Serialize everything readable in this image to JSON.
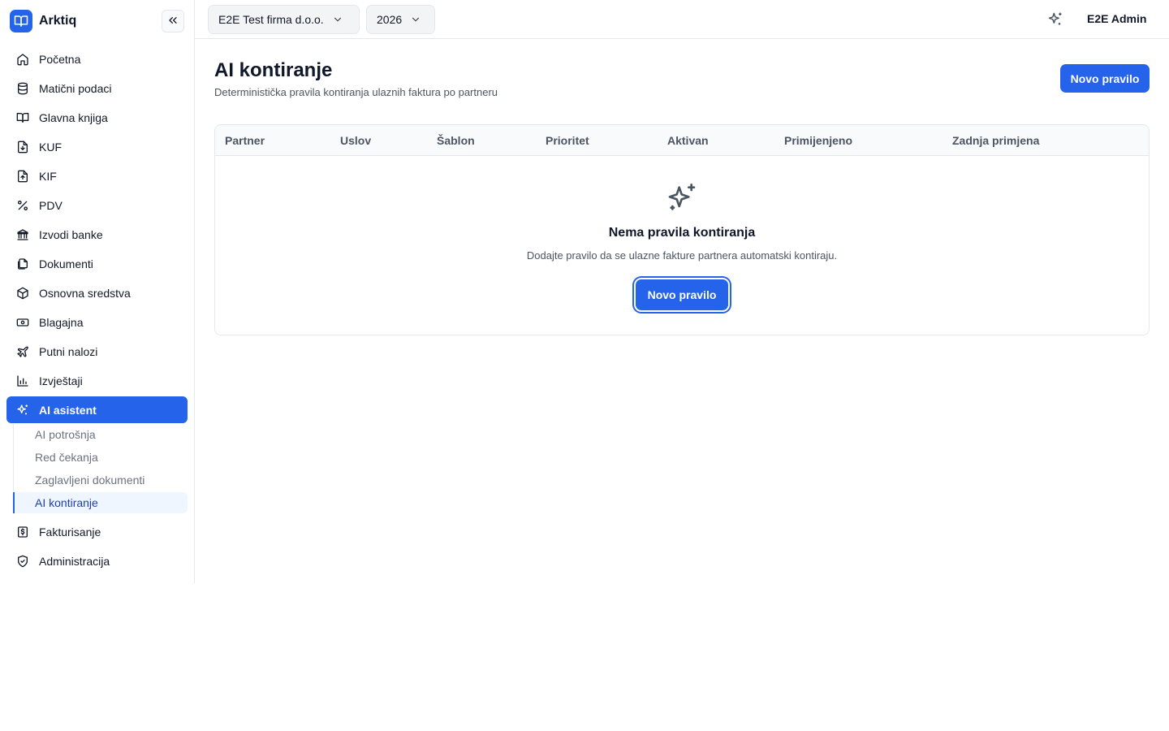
{
  "app": {
    "name": "Arktiq"
  },
  "topbar": {
    "company": "E2E Test firma d.o.o.",
    "year": "2026",
    "user": "E2E Admin"
  },
  "sidebar": {
    "items": [
      {
        "label": "Početna",
        "icon": "home-icon"
      },
      {
        "label": "Matični podaci",
        "icon": "database-icon"
      },
      {
        "label": "Glavna knjiga",
        "icon": "book-open-icon"
      },
      {
        "label": "KUF",
        "icon": "file-download-icon"
      },
      {
        "label": "KIF",
        "icon": "file-upload-icon"
      },
      {
        "label": "PDV",
        "icon": "percent-icon"
      },
      {
        "label": "Izvodi banke",
        "icon": "bank-icon"
      },
      {
        "label": "Dokumenti",
        "icon": "files-icon"
      },
      {
        "label": "Osnovna sredstva",
        "icon": "package-icon"
      },
      {
        "label": "Blagajna",
        "icon": "banknote-icon"
      },
      {
        "label": "Putni nalozi",
        "icon": "plane-icon"
      },
      {
        "label": "Izvještaji",
        "icon": "bar-chart-icon"
      },
      {
        "label": "AI asistent",
        "icon": "sparkles-icon"
      },
      {
        "label": "Fakturisanje",
        "icon": "invoice-dollar-icon"
      },
      {
        "label": "Administracija",
        "icon": "shield-check-icon"
      }
    ],
    "ai_sub": [
      {
        "label": "AI potrošnja"
      },
      {
        "label": "Red čekanja"
      },
      {
        "label": "Zaglavljeni dokumenti"
      },
      {
        "label": "AI kontiranje"
      }
    ]
  },
  "page": {
    "title": "AI kontiranje",
    "subtitle": "Deterministička pravila kontiranja ulaznih faktura po partneru",
    "new_rule_label": "Novo pravilo"
  },
  "table": {
    "columns": [
      "Partner",
      "Uslov",
      "Šablon",
      "Prioritet",
      "Aktivan",
      "Primijenjeno",
      "Zadnja primjena"
    ]
  },
  "empty_state": {
    "title": "Nema pravila kontiranja",
    "description": "Dodajte pravilo da se ulazne fakture partnera automatski kontiraju.",
    "button_label": "Novo pravilo"
  },
  "colors": {
    "accent": "#2563eb",
    "active_sub_bg": "#eff6ff"
  }
}
